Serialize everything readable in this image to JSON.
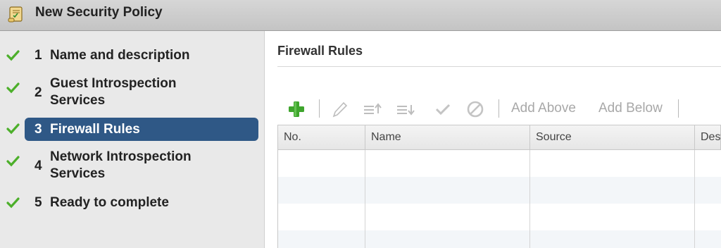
{
  "window": {
    "title": "New Security Policy",
    "icon": "scroll-document-icon"
  },
  "steps": [
    {
      "num": "1",
      "label": "Name and description",
      "completed": true,
      "active": false
    },
    {
      "num": "2",
      "label": "Guest Introspection Services",
      "completed": true,
      "active": false
    },
    {
      "num": "3",
      "label": "Firewall Rules",
      "completed": true,
      "active": true
    },
    {
      "num": "4",
      "label": "Network Introspection Services",
      "completed": true,
      "active": false
    },
    {
      "num": "5",
      "label": "Ready to complete",
      "completed": true,
      "active": false
    }
  ],
  "main": {
    "title": "Firewall Rules",
    "toolbar": {
      "add_icon": "plus-icon",
      "edit_icon": "pencil-icon",
      "move_up_icon": "move-up-icon",
      "move_down_icon": "move-down-icon",
      "enable_icon": "checkmark-icon",
      "disable_icon": "disable-icon",
      "add_above": "Add Above",
      "add_below": "Add Below"
    },
    "table": {
      "columns": [
        "No.",
        "Name",
        "Source",
        "Dest"
      ],
      "rows": []
    }
  },
  "colors": {
    "active_step": "#2f5886",
    "check_green": "#4caf2a",
    "add_green": "#3fa52d",
    "disabled_text": "#a8a8a8"
  }
}
